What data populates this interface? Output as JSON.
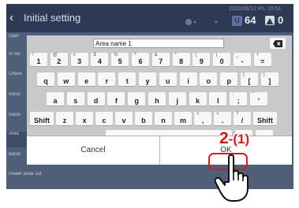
{
  "header": {
    "back_glyph": "‹",
    "title": "Initial setting",
    "datetime": "2020/06/12 Fri. 15:51",
    "count_primary": "64",
    "count_secondary": "0"
  },
  "sidebar": {
    "items": [
      {
        "label": "Oper"
      },
      {
        "label": "IP Ad"
      },
      {
        "label": "Check"
      },
      {
        "label": "Indoo"
      },
      {
        "label": "Indoo"
      },
      {
        "label": "Area"
      },
      {
        "label": "Backl"
      },
      {
        "label": "Power peak cut"
      }
    ]
  },
  "keyboard": {
    "input_value": "Area name 1",
    "rows": [
      [
        {
          "main": "1",
          "shift": "!"
        },
        {
          "main": "2",
          "shift": "@"
        },
        {
          "main": "3",
          "shift": "#"
        },
        {
          "main": "4",
          "shift": "$"
        },
        {
          "main": "5",
          "shift": "%"
        },
        {
          "main": "6",
          "shift": "^"
        },
        {
          "main": "7",
          "shift": "&"
        },
        {
          "main": "8",
          "shift": "*"
        },
        {
          "main": "9",
          "shift": "("
        },
        {
          "main": "0",
          "shift": ")"
        },
        {
          "main": "-",
          "shift": "_"
        },
        {
          "main": "=",
          "shift": "+"
        }
      ],
      [
        {
          "main": "q"
        },
        {
          "main": "w"
        },
        {
          "main": "e"
        },
        {
          "main": "r"
        },
        {
          "main": "t"
        },
        {
          "main": "y"
        },
        {
          "main": "u"
        },
        {
          "main": "i"
        },
        {
          "main": "o"
        },
        {
          "main": "p"
        },
        {
          "main": "[",
          "shift": "{"
        },
        {
          "main": "]",
          "shift": "}"
        }
      ],
      [
        {
          "main": "a"
        },
        {
          "main": "s"
        },
        {
          "main": "d"
        },
        {
          "main": "f"
        },
        {
          "main": "g"
        },
        {
          "main": "h"
        },
        {
          "main": "j"
        },
        {
          "main": "k"
        },
        {
          "main": "l"
        },
        {
          "main": ";",
          "shift": ":"
        },
        {
          "main": "'",
          "shift": "\""
        }
      ],
      [
        {
          "main": "Shift"
        },
        {
          "main": "z"
        },
        {
          "main": "x"
        },
        {
          "main": "c"
        },
        {
          "main": "v"
        },
        {
          "main": "b"
        },
        {
          "main": "n"
        },
        {
          "main": "m"
        },
        {
          "main": ",",
          "shift": "<"
        },
        {
          "main": ".",
          "shift": ">"
        },
        {
          "main": "/",
          "shift": "?"
        },
        {
          "main": "Shift"
        }
      ],
      [
        {
          "main": ""
        },
        {
          "main": "←"
        },
        {
          "main": "→"
        }
      ]
    ]
  },
  "dialog": {
    "cancel_label": "Cancel",
    "ok_label": "OK"
  },
  "annotation": {
    "step": "2",
    "sub": "-(1)",
    "color": "#cc1f1f"
  },
  "colors": {
    "header_bg": "#2d3a55",
    "screen_bg": "#4f5e79",
    "keyboard_bg": "#c9c9c9",
    "key_bg": "#f7f7f7"
  }
}
